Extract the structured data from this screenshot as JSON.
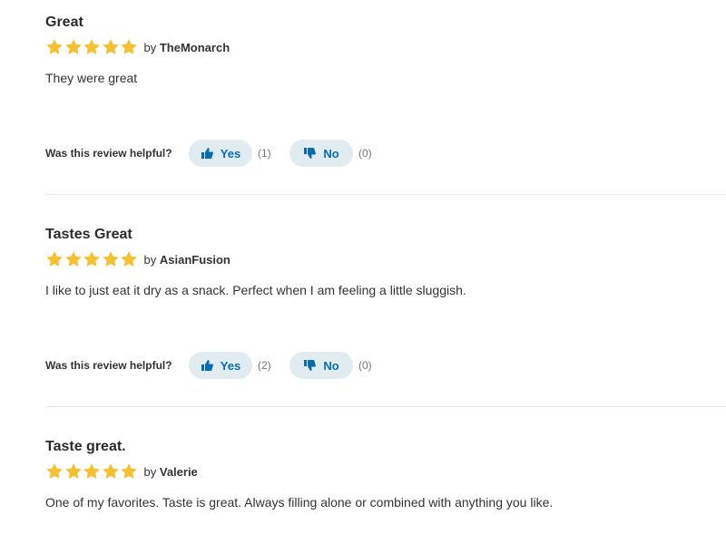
{
  "reviews": [
    {
      "title": "Great",
      "rating": 5,
      "by_label": "by",
      "author": "TheMonarch",
      "body": "They were great",
      "helpful": {
        "question": "Was this review helpful?",
        "yes_label": "Yes",
        "yes_count": "(1)",
        "no_label": "No",
        "no_count": "(0)"
      }
    },
    {
      "title": "Tastes Great",
      "rating": 5,
      "by_label": "by",
      "author": "AsianFusion",
      "body": "I like to just eat it dry as a snack. Perfect when I am feeling a little sluggish.",
      "helpful": {
        "question": "Was this review helpful?",
        "yes_label": "Yes",
        "yes_count": "(2)",
        "no_label": "No",
        "no_count": "(0)"
      }
    },
    {
      "title": "Taste great.",
      "rating": 5,
      "by_label": "by",
      "author": "Valerie",
      "body": "One of my favorites. Taste is great. Always filling alone or combined with anything you like."
    }
  ],
  "colors": {
    "star": "#f6c130",
    "accent": "#0a6ab0",
    "button_bg": "#e1ecf0"
  },
  "icons": {
    "star": "star-icon",
    "yes": "thumbs-up-icon",
    "no": "thumbs-down-icon"
  }
}
